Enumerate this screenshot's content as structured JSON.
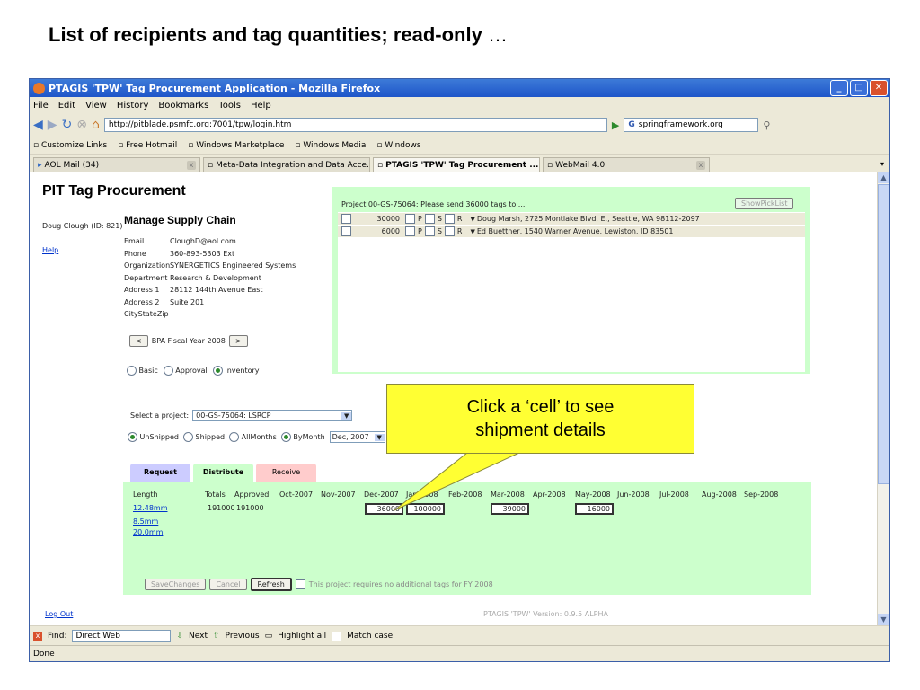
{
  "slide": {
    "title": "List of recipients and tag quantities; read-only",
    "title_suffix": "…"
  },
  "browser": {
    "title": "PTAGIS 'TPW' Tag Procurement Application - Mozilla Firefox",
    "menu": [
      "File",
      "Edit",
      "View",
      "History",
      "Bookmarks",
      "Tools",
      "Help"
    ],
    "url": "http://pitblade.psmfc.org:7001/tpw/login.htm",
    "search": "springframework.org",
    "bookmarks": [
      "Customize Links",
      "Free Hotmail",
      "Windows Marketplace",
      "Windows Media",
      "Windows"
    ],
    "tabs": [
      "AOL Mail (34)",
      "Meta-Data Integration and Data Acce...",
      "PTAGIS 'TPW' Tag Procurement ...",
      "WebMail 4.0"
    ],
    "find_label": "Find:",
    "find_value": "Direct Web",
    "find_next": "Next",
    "find_previous": "Previous",
    "find_highlight": "Highlight all",
    "find_match": "Match case",
    "status": "Done"
  },
  "page": {
    "heading": "PIT Tag Procurement",
    "user": "Doug Clough (ID: 821)",
    "help": "Help",
    "logout": "Log Out",
    "section": "Manage Supply Chain",
    "contact": [
      {
        "label": "Email",
        "value": "CloughD@aol.com"
      },
      {
        "label": "Phone",
        "value": "360-893-5303 Ext"
      },
      {
        "label": "Organization",
        "value": "SYNERGETICS Engineered Systems"
      },
      {
        "label": "Department",
        "value": "Research & Development"
      },
      {
        "label": "Address 1",
        "value": "28112 144th Avenue East"
      },
      {
        "label": "Address 2",
        "value": "Suite 201"
      },
      {
        "label": "CityStateZip",
        "value": ""
      }
    ],
    "fiscal_year": "BPA Fiscal Year 2008",
    "view_modes": [
      "Basic",
      "Approval",
      "Inventory"
    ],
    "select_project_label": "Select a project:",
    "project": "00-GS-75064: LSRCP",
    "ship_filters": [
      "UnShipped",
      "Shipped",
      "AllMonths",
      "ByMonth"
    ],
    "month": "Dec, 2007",
    "tabs": [
      "Request",
      "Distribute",
      "Receive"
    ],
    "grid": {
      "headers": [
        "Length",
        "Totals",
        "Approved",
        "Oct-2007",
        "Nov-2007",
        "Dec-2007",
        "Jan-2008",
        "Feb-2008",
        "Mar-2008",
        "Apr-2008",
        "May-2008",
        "Jun-2008",
        "Jul-2008",
        "Aug-2008",
        "Sep-2008"
      ],
      "lengths": [
        "12.48mm",
        "8.5mm",
        "20.0mm"
      ],
      "total": "191000",
      "approved": "191000",
      "cells": {
        "dec": "36000",
        "jan": "100000",
        "mar": "39000",
        "may": "16000"
      }
    },
    "actions": {
      "save": "SaveChanges",
      "cancel": "Cancel",
      "refresh": "Refresh"
    },
    "notice": "This project requires no additional tags for FY 2008",
    "version": "PTAGIS 'TPW' Version: 0.9.5 ALPHA",
    "recipients_panel": {
      "header": "Project 00-GS-75064: Please send 36000 tags to ...",
      "button": "ShowPickList",
      "rows": [
        {
          "qty": "30000",
          "flags": [
            "P",
            "S",
            "R"
          ],
          "address": "Doug Marsh, 2725 Montlake Blvd. E., Seattle, WA 98112-2097"
        },
        {
          "qty": "6000",
          "flags": [
            "P",
            "S",
            "R"
          ],
          "address": "Ed Buettner, 1540 Warner Avenue, Lewiston, ID 83501"
        }
      ]
    }
  },
  "callout": {
    "line1": "Click a ‘cell’ to see",
    "line2": "shipment details"
  },
  "colors": {
    "panel": "#ccffcc",
    "tab_request": "#ccccff",
    "tab_receive": "#ffcccc",
    "callout": "#ffff33"
  }
}
